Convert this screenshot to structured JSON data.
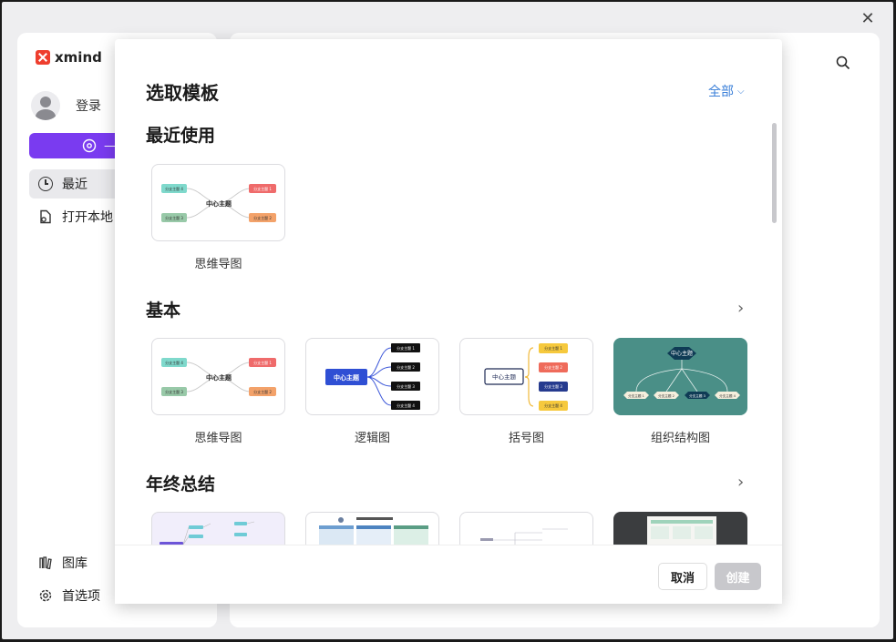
{
  "window": {
    "close_icon": "close-icon"
  },
  "sidebar": {
    "logo_text": "xmind",
    "login_label": "登录",
    "new_button_label": "—",
    "nav": [
      {
        "label": "最近",
        "icon": "clock-icon"
      },
      {
        "label": "打开本地",
        "icon": "open-file-icon"
      }
    ],
    "bottom": [
      {
        "label": "图库",
        "icon": "library-icon"
      },
      {
        "label": "首选项",
        "icon": "gear-icon"
      }
    ]
  },
  "modal": {
    "title": "选取模板",
    "filter_label": "全部",
    "sections": {
      "recent": {
        "title": "最近使用",
        "cards": [
          {
            "label": "思维导图"
          }
        ]
      },
      "basic": {
        "title": "基本",
        "cards": [
          {
            "label": "思维导图"
          },
          {
            "label": "逻辑图"
          },
          {
            "label": "括号图"
          },
          {
            "label": "组织结构图"
          }
        ]
      },
      "year_end": {
        "title": "年终总结"
      }
    },
    "cancel_label": "取消",
    "create_label": "创建"
  },
  "thumb_text": {
    "central": "中心主题",
    "b1": "分支主题 1",
    "b2": "分支主题 2",
    "b3": "分支主题 3",
    "b4": "分支主题 4"
  },
  "colors": {
    "accent_purple": "#7a3bf0",
    "link_blue": "#3a7fd8",
    "teal": "#4a8f87"
  }
}
